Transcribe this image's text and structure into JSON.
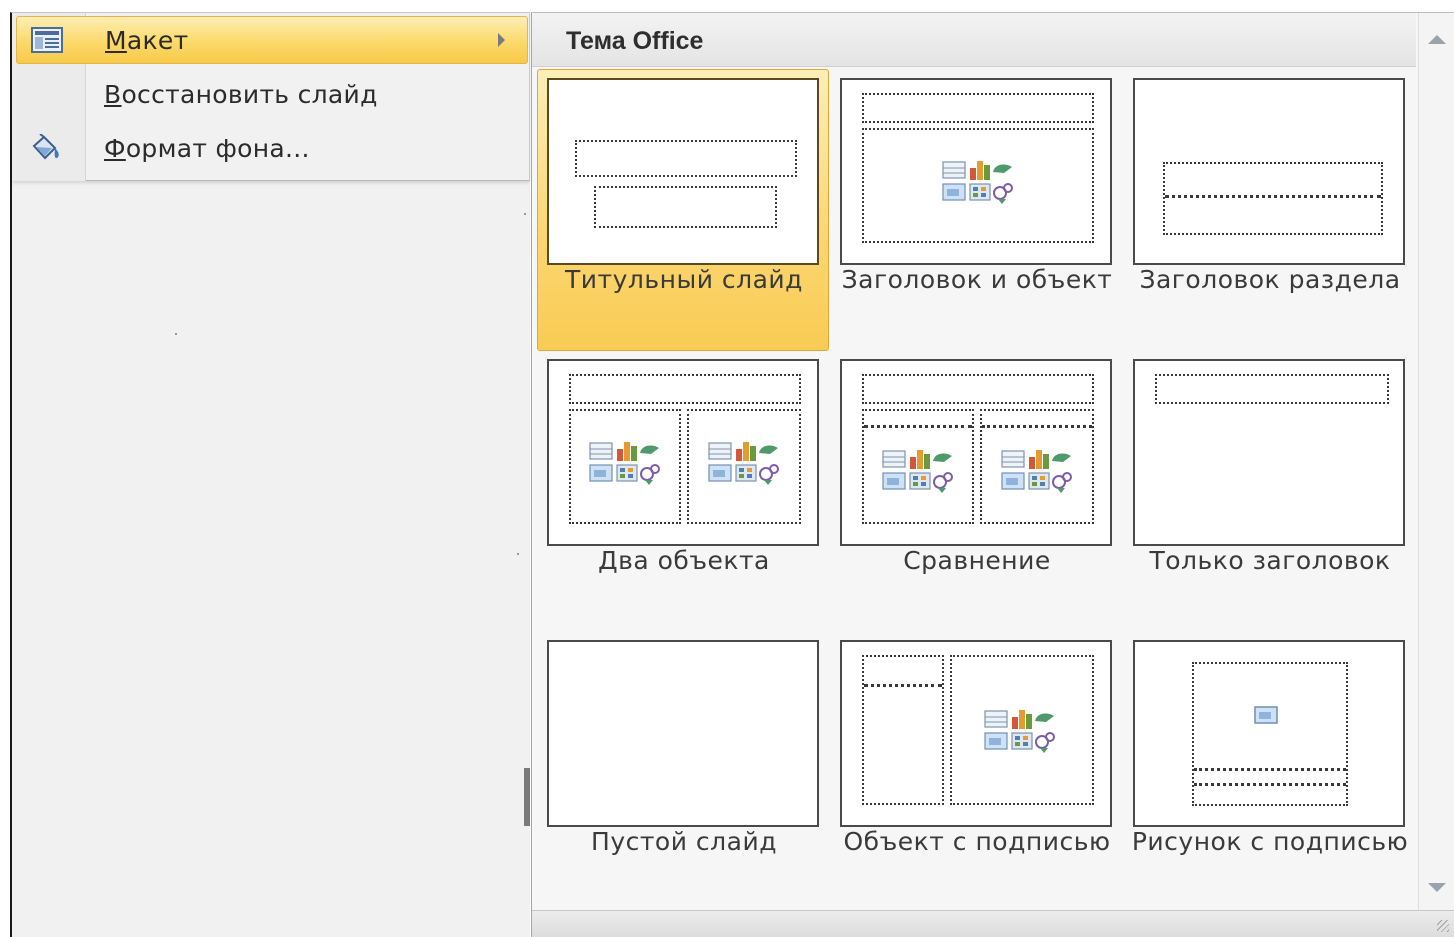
{
  "menu": {
    "items": [
      {
        "label": "Макет",
        "icon": "layout-icon",
        "highlighted": true,
        "has_submenu": true
      },
      {
        "label": "Восстановить слайд",
        "icon": "",
        "highlighted": false,
        "has_submenu": false
      },
      {
        "label": "Формат фона...",
        "icon": "paint-bucket-icon",
        "highlighted": false,
        "has_submenu": false
      }
    ]
  },
  "gallery": {
    "title": "Тема Office",
    "layouts": [
      {
        "label": "Титульный слайд",
        "selected": true
      },
      {
        "label": "Заголовок и объект",
        "selected": false
      },
      {
        "label": "Заголовок раздела",
        "selected": false
      },
      {
        "label": "Два объекта",
        "selected": false
      },
      {
        "label": "Сравнение",
        "selected": false
      },
      {
        "label": "Только заголовок",
        "selected": false
      },
      {
        "label": "Пустой слайд",
        "selected": false
      },
      {
        "label": "Объект с подписью",
        "selected": false
      },
      {
        "label": "Рисунок с подписью",
        "selected": false
      }
    ]
  },
  "colors": {
    "highlight": "#fbd96a",
    "selected_tile": "#f9cb55",
    "panel_bg": "#f1f1f1"
  }
}
